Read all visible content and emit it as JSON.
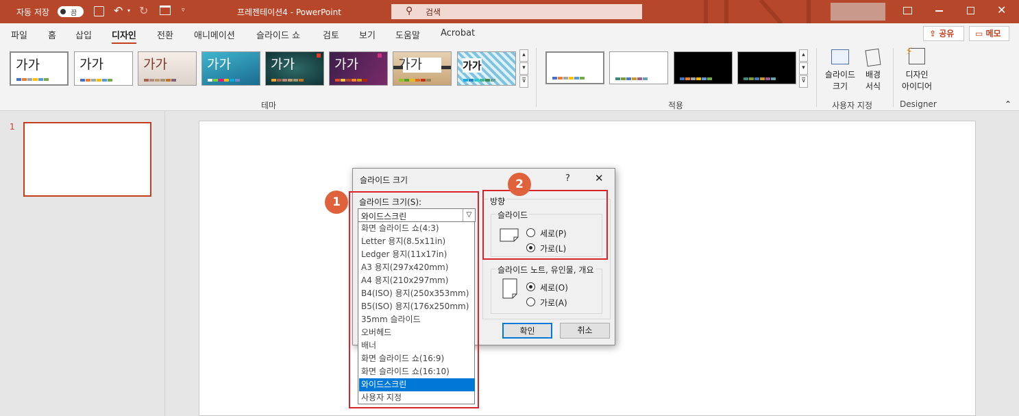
{
  "titlebar": {
    "autosave": "자동 저장",
    "toggle": "끔",
    "doc_title": "프레젠테이션4  -  PowerPoint",
    "search": "검색"
  },
  "tabs": [
    "파일",
    "홈",
    "삽입",
    "디자인",
    "전환",
    "애니메이션",
    "슬라이드 쇼",
    "검토",
    "보기",
    "도움말",
    "Acrobat"
  ],
  "share": "공유",
  "comment": "메모",
  "ribbon": {
    "theme_glyph": "가가",
    "group_themes": "테마",
    "group_variants": "적용",
    "slide_size_1": "슬라이드",
    "slide_size_2": "크기",
    "bg_1": "배경",
    "bg_2": "서식",
    "design_1": "디자인",
    "design_2": "아이디어",
    "group_customize": "사용자 지정",
    "group_designer": "Designer"
  },
  "slide_number": "1",
  "dialog": {
    "title": "슬라이드 크기",
    "help": "?",
    "close": "✕",
    "size_label": "슬라이드 크기(S):",
    "selected": "와이드스크린",
    "options": [
      "화면 슬라이드 쇼(4:3)",
      "Letter 용지(8.5x11in)",
      "Ledger 용지(11x17in)",
      "A3 용지(297x420mm)",
      "A4 용지(210x297mm)",
      "B4(ISO) 용지(250x353mm)",
      "B5(ISO) 용지(176x250mm)",
      "35mm 슬라이드",
      "오버헤드",
      "배너",
      "화면 슬라이드 쇼(16:9)",
      "화면 슬라이드 쇼(16:10)",
      "와이드스크린",
      "사용자 지정"
    ],
    "orientation": "방향",
    "slides_group": "슬라이드",
    "portrait": "세로(P)",
    "landscape": "가로(L)",
    "notes_group": "슬라이드 노트, 유인물, 개요",
    "notes_portrait": "세로(O)",
    "notes_landscape": "가로(A)",
    "ok": "확인",
    "cancel": "취소"
  },
  "badges": [
    "1",
    "2"
  ],
  "colors": {
    "titlebar": "#b7472a",
    "accent": "#c43e1c",
    "highlight": "#d8232a",
    "selection": "#0078d7"
  }
}
